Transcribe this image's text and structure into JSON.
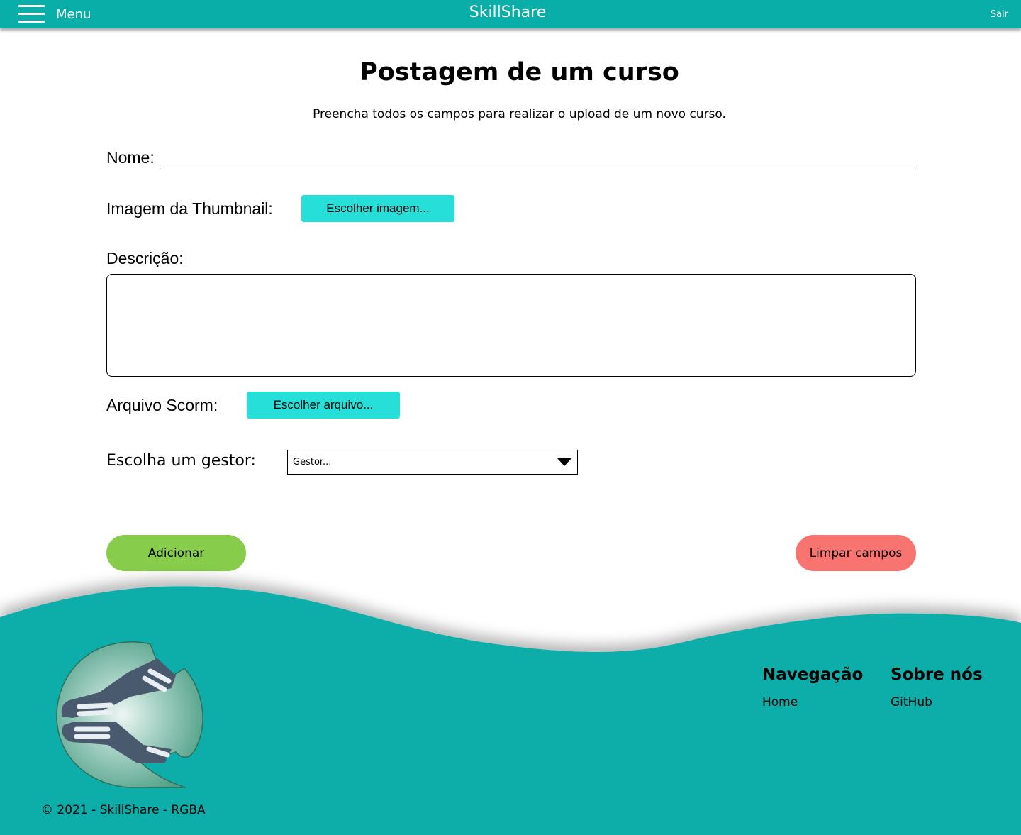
{
  "topbar": {
    "menu_label": "Menu",
    "brand": "SkillShare",
    "logout": "Sair"
  },
  "page": {
    "title": "Postagem de um curso",
    "subtitle": "Preencha todos os campos para realizar o upload de um novo curso."
  },
  "form": {
    "name_label": "Nome:",
    "name_value": "",
    "thumbnail_label": "Imagem da Thumbnail:",
    "thumbnail_button": "Escolher imagem...",
    "description_label": "Descrição:",
    "description_value": "",
    "scorm_label": "Arquivo Scorm:",
    "scorm_button": "Escolher arquivo...",
    "manager_label": "Escolha um gestor:",
    "manager_selected": "Gestor..."
  },
  "actions": {
    "add": "Adicionar",
    "clear": "Limpar campos"
  },
  "footer": {
    "nav_heading": "Navegação",
    "nav_home": "Home",
    "about_heading": "Sobre nós",
    "about_github": "GitHub",
    "copyright": "© 2021 - SkillShare - RGBA"
  },
  "colors": {
    "brand_teal": "#0aaea9",
    "file_button": "#27dfd9",
    "add_button": "#87cd4b",
    "clear_button": "#f87470"
  },
  "icons": {
    "menu": "hamburger-icon",
    "select_arrow": "caret-down-icon",
    "logo": "skillshare-logo"
  }
}
